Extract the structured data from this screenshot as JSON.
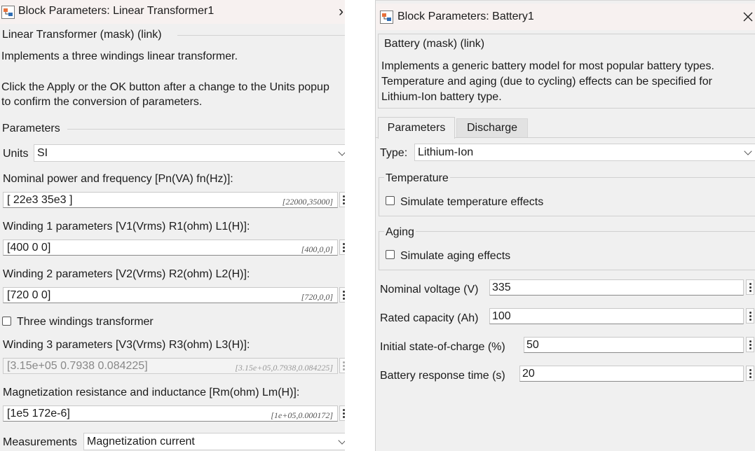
{
  "left": {
    "title": "Block Parameters: Linear Transformer1",
    "mask_title": "Linear Transformer (mask) (link)",
    "desc1": "Implements a three windings linear transformer.",
    "desc2a": "Click the Apply or the OK button after a change to the Units popup",
    "desc2b": "to confirm the conversion of parameters.",
    "params_header": "Parameters",
    "units_label": "Units",
    "units_value": "SI",
    "nominal_label": "Nominal power and frequency [Pn(VA) fn(Hz)]:",
    "nominal_value": "[ 22e3 35e3 ]",
    "nominal_eval": "[22000,35000]",
    "w1_label": "Winding 1 parameters [V1(Vrms) R1(ohm) L1(H)]:",
    "w1_value": "[400 0 0]",
    "w1_eval": "[400,0,0]",
    "w2_label": "Winding 2 parameters [V2(Vrms) R2(ohm) L2(H)]:",
    "w2_value": "[720 0 0]",
    "w2_eval": "[720,0,0]",
    "three_windings_label": "Three windings transformer",
    "w3_label": "Winding 3 parameters [V3(Vrms) R3(ohm) L3(H)]:",
    "w3_value": "[3.15e+05 0.7938 0.084225]",
    "w3_eval": "[3.15e+05,0.7938,0.084225]",
    "mag_label": "Magnetization resistance and inductance [Rm(ohm) Lm(H)]:",
    "mag_value": "[1e5 172e-6]",
    "mag_eval": "[1e+05,0.000172]",
    "meas_label": "Measurements",
    "meas_value": "Magnetization current"
  },
  "right": {
    "title": "Block Parameters: Battery1",
    "mask_title": "Battery (mask) (link)",
    "desc1": "Implements a generic battery model for most popular battery types.",
    "desc2": "Temperature and aging (due to cycling) effects can be specified for",
    "desc3": "Lithium-Ion battery type.",
    "tab_params": "Parameters",
    "tab_discharge": "Discharge",
    "type_label": "Type:",
    "type_value": "Lithium-Ion",
    "temp_group": "Temperature",
    "temp_check": "Simulate temperature effects",
    "aging_group": "Aging",
    "aging_check": "Simulate aging effects",
    "nv_label": "Nominal voltage (V)",
    "nv_value": "335",
    "rc_label": "Rated capacity (Ah)",
    "rc_value": "100",
    "soc_label": "Initial state-of-charge (%)",
    "soc_value": "50",
    "rt_label": "Battery response time (s)",
    "rt_value": "20"
  }
}
